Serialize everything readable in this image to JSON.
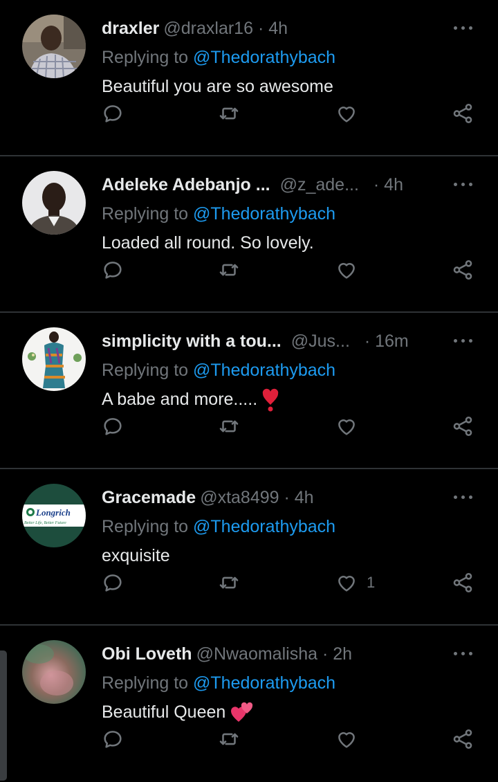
{
  "replying_prefix": "Replying to",
  "tweets": [
    {
      "name": "draxler",
      "handle": "@draxlar16",
      "time": "· 4h",
      "replying_to": "@Thedorathybach",
      "text": "Beautiful you are so awesome",
      "like_count": "",
      "avatar": "man-in-checked-shirt"
    },
    {
      "name": "Adeleke Adebanjo ...",
      "handle": "@z_ade...",
      "time": "· 4h",
      "replying_to": "@Thedorathybach",
      "text": "Loaded all round.  So lovely.",
      "like_count": "",
      "avatar": "man-headshot"
    },
    {
      "name": "simplicity with a tou...",
      "handle": "@Jus...",
      "time": "· 16m",
      "replying_to": "@Thedorathybach",
      "text": "A babe and more.....",
      "emoji": "heart-exclamation",
      "like_count": "",
      "avatar": "woman-in-print-dress"
    },
    {
      "name": "Gracemade",
      "handle": "@xta8499",
      "time": "· 4h",
      "replying_to": "@Thedorathybach",
      "text": "exquisite",
      "like_count": "1",
      "avatar": "longrich-logo",
      "avatar_text": "Longrich",
      "avatar_tagline": "Better Life, Better Future"
    },
    {
      "name": "Obi Loveth",
      "handle": "@Nwaomalisha",
      "time": "· 2h",
      "replying_to": "@Thedorathybach",
      "text": "Beautiful Queen",
      "emoji": "two-hearts",
      "like_count": "",
      "avatar": "blurred-photo"
    }
  ],
  "colors": {
    "background": "#000000",
    "text": "#e7e9ea",
    "muted": "#71767b",
    "accent": "#1d9bf0",
    "divider": "#2f3336"
  },
  "icons": [
    "reply-icon",
    "retweet-icon",
    "like-icon",
    "share-icon",
    "more-icon"
  ]
}
